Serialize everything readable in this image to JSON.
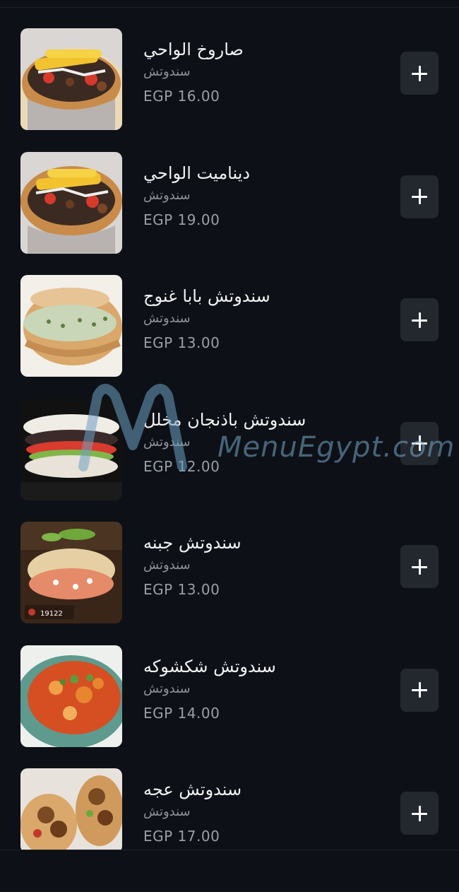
{
  "menu": {
    "items": [
      {
        "name": "صاروخ الواحي",
        "category": "سندوتش",
        "price": "EGP 16.00",
        "image": "shawarma-wrap"
      },
      {
        "name": "ديناميت الواحي",
        "category": "سندوتش",
        "price": "EGP 19.00",
        "image": "shawarma-wrap"
      },
      {
        "name": "سندوتش بابا غنوج",
        "category": "سندوتش",
        "price": "EGP 13.00",
        "image": "pita-sandwich"
      },
      {
        "name": "سندوتش باذنجان مخلل",
        "category": "سندوتش",
        "price": "EGP 12.00",
        "image": "eggplant-sandwich"
      },
      {
        "name": "سندوتش جبنه",
        "category": "سندوتش",
        "price": "EGP 13.00",
        "image": "cheese-pita"
      },
      {
        "name": "سندوتش شكشوكه",
        "category": "سندوتش",
        "price": "EGP 14.00",
        "image": "shakshuka-plate"
      },
      {
        "name": "سندوتش عجه",
        "category": "سندوتش",
        "price": "EGP 17.00",
        "image": "falafel-wrap"
      }
    ],
    "add_icon": "plus-icon"
  },
  "watermark": {
    "text": "MenuEgypt.com"
  },
  "colors": {
    "background": "#0d1117",
    "button": "#23282e",
    "muted_text": "#8e939a"
  }
}
